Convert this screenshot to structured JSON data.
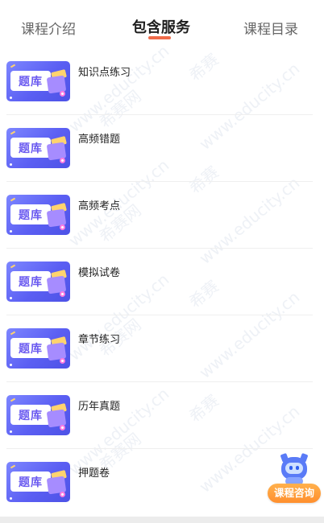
{
  "tabs": [
    {
      "label": "课程介绍",
      "active": false
    },
    {
      "label": "包含服务",
      "active": true
    },
    {
      "label": "课程目录",
      "active": false
    }
  ],
  "thumbnail_text": "题库",
  "services": [
    {
      "title": "知识点练习"
    },
    {
      "title": "高频错题"
    },
    {
      "title": "高频考点"
    },
    {
      "title": "模拟试卷"
    },
    {
      "title": "章节练习"
    },
    {
      "title": "历年真题"
    },
    {
      "title": "押题卷"
    }
  ],
  "watermark_texts": [
    "希赛",
    "希赛网",
    "www.educity.cn"
  ],
  "helper": {
    "label": "课程咨询",
    "icon": "robot-icon"
  },
  "colors": {
    "accent": "#ef6b4a",
    "thumb": "#5b5ff3",
    "helper": "#ff9a36"
  }
}
